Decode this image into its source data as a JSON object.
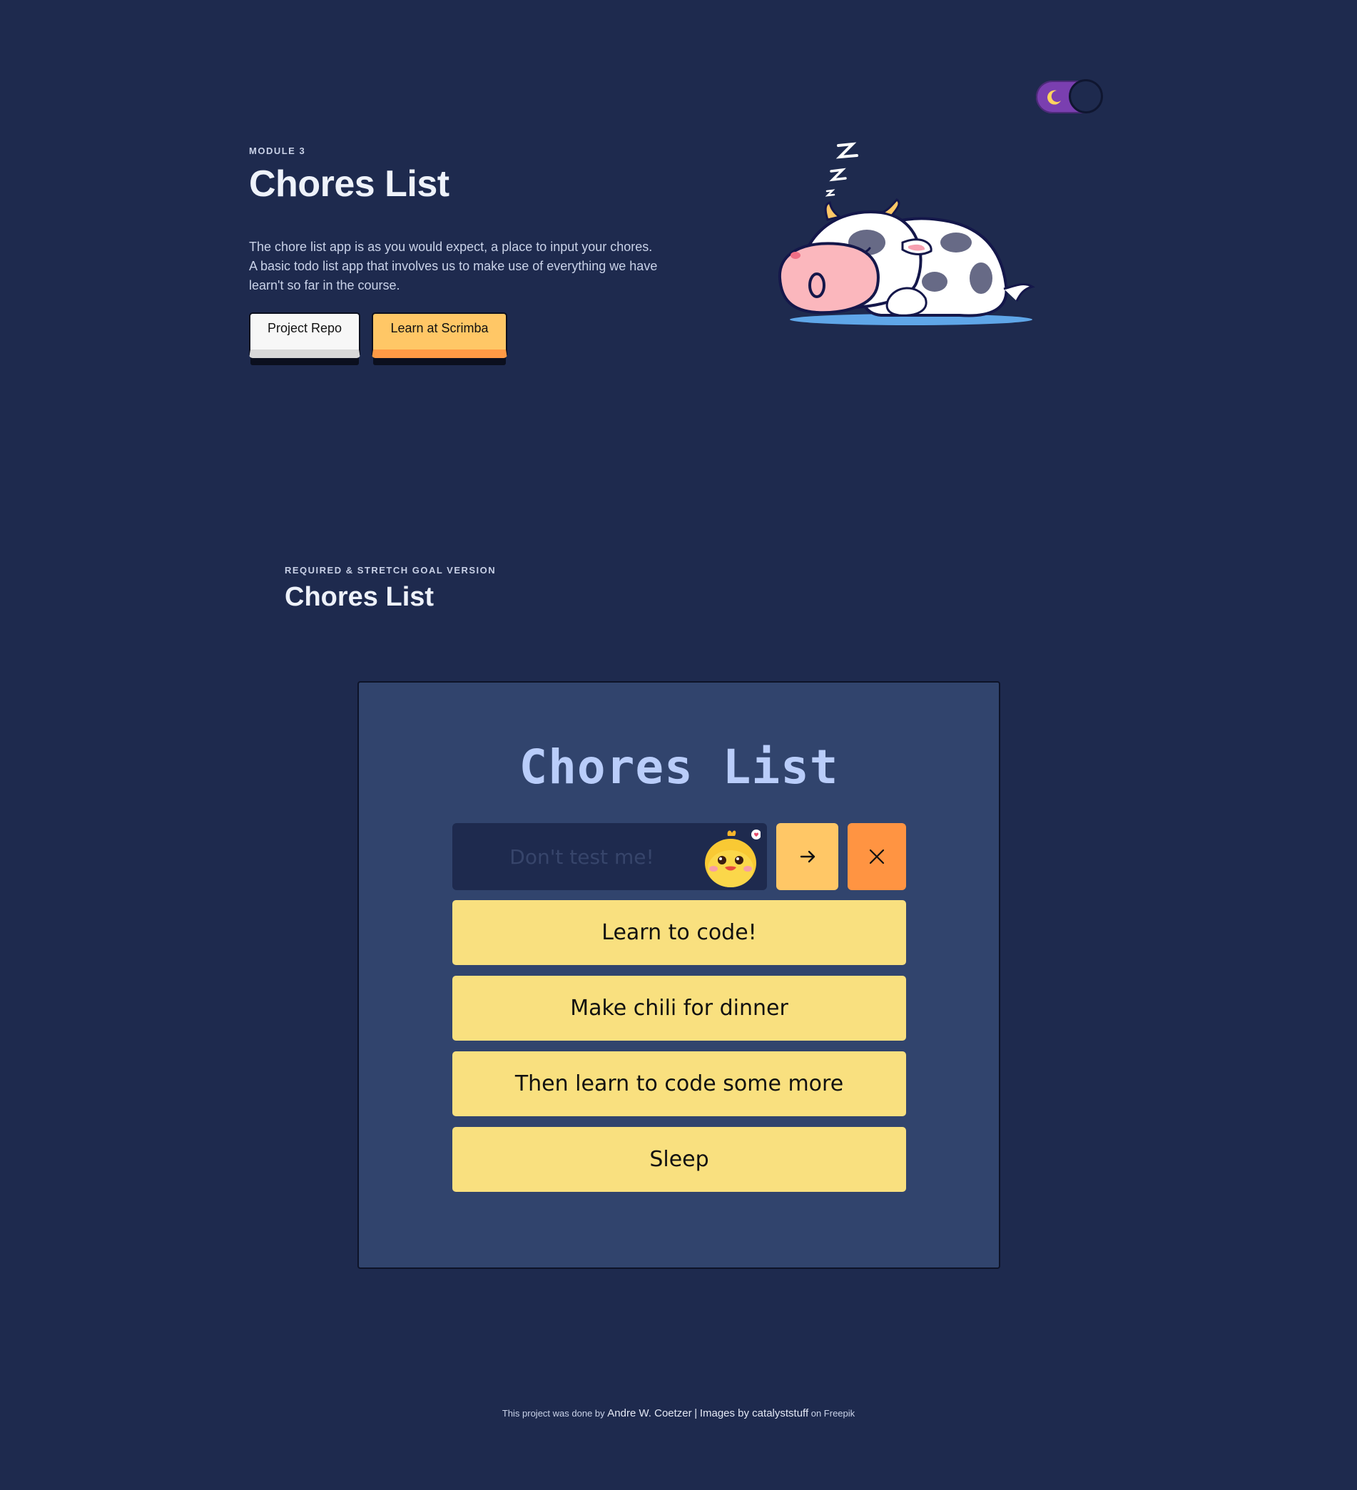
{
  "theme_toggle": {
    "state": "dark",
    "icon": "moon-icon"
  },
  "hero": {
    "eyebrow": "MODULE 3",
    "title": "Chores List",
    "description_lines": [
      "The chore list app is as you would expect, a place to input your chores.",
      "A basic todo list app that involves us to make use of everything we have",
      "learn't so far in the course."
    ],
    "repo_button": "Project Repo",
    "scrimba_button": "Learn at Scrimba"
  },
  "section": {
    "eyebrow": "REQUIRED & STRETCH GOAL VERSION",
    "title": "Chores List"
  },
  "app": {
    "title": "Chores List",
    "input_placeholder": "Don't test me!",
    "add_icon": "arrow-right-icon",
    "clear_icon": "close-icon",
    "chores": [
      "Learn to code!",
      "Make chili for dinner",
      "Then learn to code some more",
      "Sleep"
    ]
  },
  "footer": {
    "prefix": "This project was done by",
    "author": "Andre W. Coetzer",
    "separator": "|",
    "images_by": "Images by catalyststuff",
    "suffix": "on Freepik"
  },
  "colors": {
    "background": "#1e2a4e",
    "card": "#31446d",
    "chore": "#f9e07f",
    "add_button": "#ffc766",
    "clear_button": "#ff9442",
    "toggle": "#7a3fb0"
  }
}
